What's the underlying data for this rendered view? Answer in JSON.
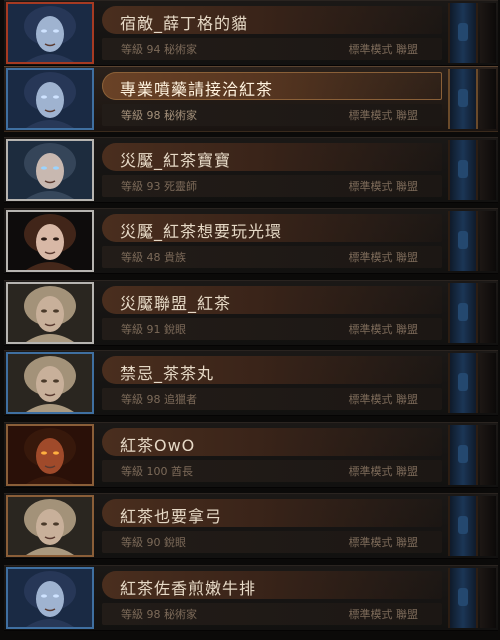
{
  "characters": [
    {
      "name": "宿敵_薛丁格的貓",
      "info": "等級 94 秘術家",
      "mode": "標準模式 聯盟",
      "frame": "red",
      "portrait": "pale-undead-icon",
      "selected": false
    },
    {
      "name": "專業噴藥請接洽紅茶",
      "info": "等級 98 秘術家",
      "mode": "標準模式 聯盟",
      "frame": "blue",
      "portrait": "pale-undead-icon",
      "selected": true
    },
    {
      "name": "災魘_紅茶寶寶",
      "info": "等級 93 死靈師",
      "mode": "標準模式 聯盟",
      "frame": "silver",
      "portrait": "witch-icon",
      "selected": false
    },
    {
      "name": "災魘_紅茶想要玩光環",
      "info": "等級 48 貴族",
      "mode": "標準模式 聯盟",
      "frame": "silver",
      "portrait": "scion-icon",
      "selected": false
    },
    {
      "name": "災魘聯盟_紅茶",
      "info": "等級 91 銳眼",
      "mode": "標準模式 聯盟",
      "frame": "silver",
      "portrait": "ranger-icon",
      "selected": false
    },
    {
      "name": "禁忌_茶茶丸",
      "info": "等級 98 追獵者",
      "mode": "標準模式 聯盟",
      "frame": "blue",
      "portrait": "ranger-icon",
      "selected": false
    },
    {
      "name": "紅茶OwO",
      "info": "等級 100 酋長",
      "mode": "標準模式 聯盟",
      "frame": "bronze",
      "portrait": "marauder-icon",
      "selected": false
    },
    {
      "name": "紅茶也要拿弓",
      "info": "等級 90 銳眼",
      "mode": "標準模式 聯盟",
      "frame": "bronze",
      "portrait": "ranger-icon",
      "selected": false
    },
    {
      "name": "紅茶佐香煎嫩牛排",
      "info": "等級 98 秘術家",
      "mode": "標準模式 聯盟",
      "frame": "blue",
      "portrait": "pale-undead-icon",
      "selected": false
    }
  ]
}
